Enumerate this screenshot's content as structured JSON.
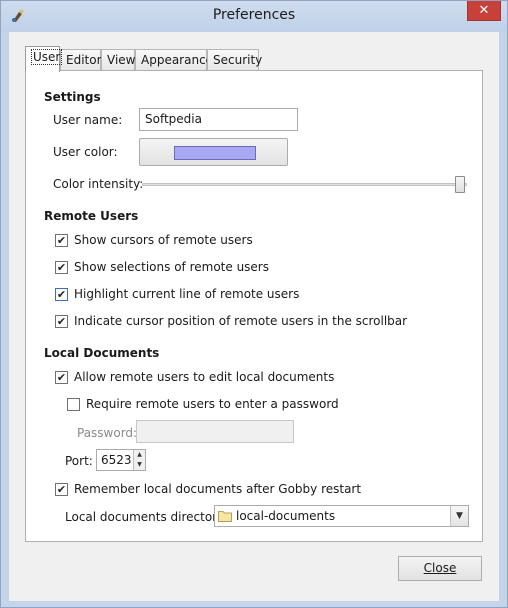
{
  "window": {
    "title": "Preferences",
    "close_glyph": "✕"
  },
  "tabs": [
    {
      "label": "User",
      "active": true
    },
    {
      "label": "Editor",
      "active": false
    },
    {
      "label": "View",
      "active": false
    },
    {
      "label": "Appearance",
      "active": false
    },
    {
      "label": "Security",
      "active": false
    }
  ],
  "settings": {
    "heading": "Settings",
    "user_name_label": "User name:",
    "user_name_value": "Softpedia",
    "user_color_label": "User color:",
    "user_color_hex": "#a8a8f5",
    "color_intensity_label": "Color intensity:",
    "color_intensity_level": 1.0
  },
  "remote_users": {
    "heading": "Remote Users",
    "options": [
      {
        "label": "Show cursors of remote users",
        "checked": true
      },
      {
        "label": "Show selections of remote users",
        "checked": true
      },
      {
        "label": "Highlight current line of remote users",
        "checked": true
      },
      {
        "label": "Indicate cursor position of remote users in the scrollbar",
        "checked": true
      }
    ]
  },
  "local_documents": {
    "heading": "Local Documents",
    "allow_edit_label": "Allow remote users to edit local documents",
    "allow_edit_checked": true,
    "require_password_label": "Require remote users to enter a password",
    "require_password_checked": false,
    "password_label": "Password:",
    "password_value": "",
    "port_label": "Port:",
    "port_value": "6523",
    "remember_label": "Remember local documents after Gobby restart",
    "remember_checked": true,
    "directory_label": "Local documents directory:",
    "directory_value": "local-documents"
  },
  "footer": {
    "close_label": "Close"
  },
  "check_glyph": "✔",
  "colors": {
    "accent": "#3c6fb5",
    "swatch": "#a8a8f5"
  }
}
